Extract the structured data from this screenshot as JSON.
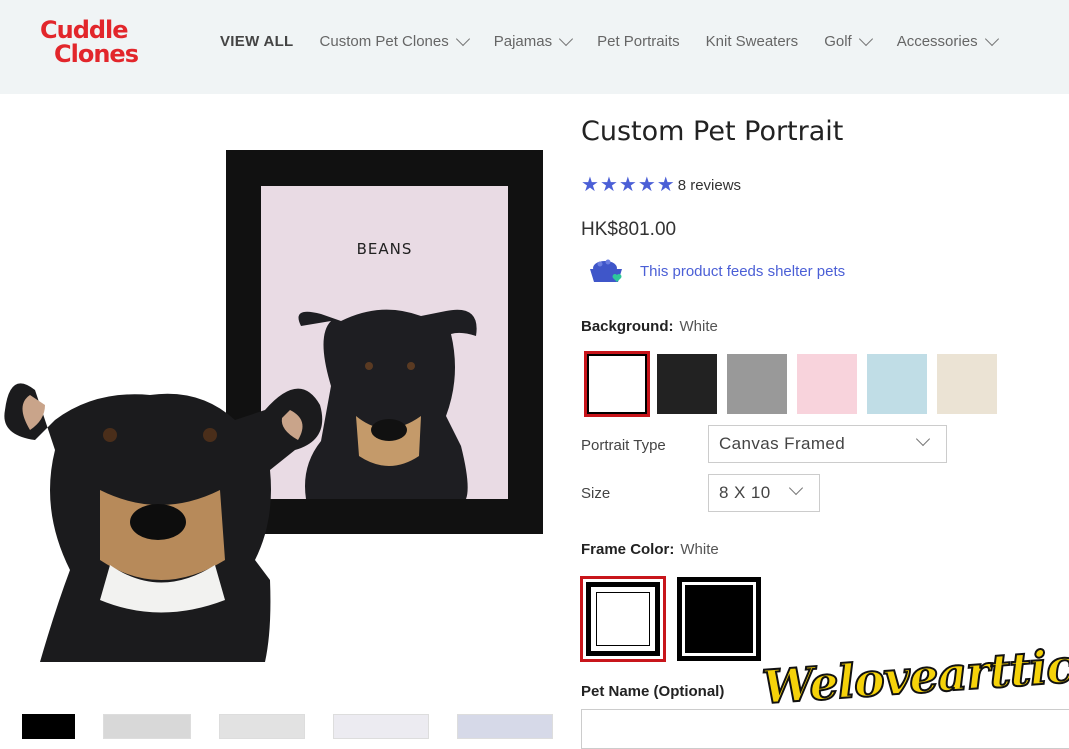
{
  "brand": {
    "line1": "Cuddle",
    "line2": "Clones",
    "color": "#e2262b"
  },
  "nav": [
    {
      "label": "VIEW ALL",
      "dropdown": false
    },
    {
      "label": "Custom Pet Clones",
      "dropdown": true
    },
    {
      "label": "Pajamas",
      "dropdown": true
    },
    {
      "label": "Pet Portraits",
      "dropdown": false
    },
    {
      "label": "Knit Sweaters",
      "dropdown": false
    },
    {
      "label": "Golf",
      "dropdown": true
    },
    {
      "label": "Accessories",
      "dropdown": true
    }
  ],
  "gallery": {
    "frame_name": "BEANS",
    "thumbnail_count": 5
  },
  "product": {
    "title": "Custom Pet Portrait",
    "rating": 5,
    "reviews": "8 reviews",
    "price": "HK$801.00",
    "feeds_text": "This product feeds shelter pets",
    "background_label": "Background:",
    "background_value": "White",
    "background_swatches": [
      "#ffffff",
      "#222222",
      "#999999",
      "#f8d3dc",
      "#c0dde6",
      "#ebe3d4"
    ],
    "portrait_type_label": "Portrait Type",
    "portrait_type_value": "Canvas Framed",
    "size_label": "Size",
    "size_value": "8 X 10",
    "frame_color_label": "Frame Color:",
    "frame_color_value": "White",
    "pet_name_label": "Pet Name (Optional)"
  },
  "watermark": "Weloveartticle",
  "colors": {
    "accent": "#4b5fd6",
    "selected_outline": "#c8151b",
    "header_bg": "#f0f4f5"
  }
}
